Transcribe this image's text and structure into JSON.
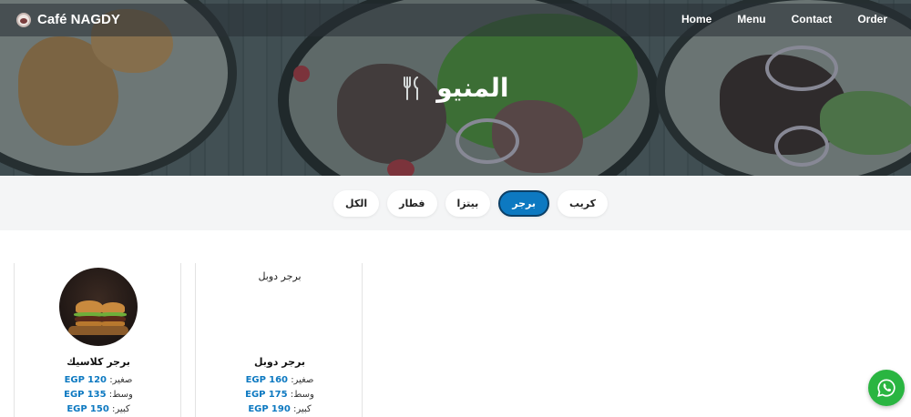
{
  "brand": {
    "name": "Café NAGDY"
  },
  "nav": {
    "links": [
      "Home",
      "Menu",
      "Contact",
      "Order"
    ]
  },
  "hero": {
    "title": "المنيو"
  },
  "filters": [
    "كريب",
    "برجر",
    "بيتزا",
    "فطار",
    "الكل"
  ],
  "active_filter": "برجر",
  "currency": "EGP",
  "cards": [
    {
      "name": "برجر كلاسيك",
      "image_alt": "",
      "prices": [
        {
          "size": "صغير:",
          "value": "120"
        },
        {
          "size": "وسط:",
          "value": "135"
        },
        {
          "size": "كبير:",
          "value": "150"
        }
      ]
    },
    {
      "name": "برجر دوبل",
      "image_alt": "برجر دوبل",
      "prices": [
        {
          "size": "صغير:",
          "value": "160"
        },
        {
          "size": "وسط:",
          "value": "175"
        },
        {
          "size": "كبير:",
          "value": "190"
        }
      ]
    }
  ],
  "colors": {
    "accent": "#0d79c1",
    "whatsapp": "#2ab541"
  },
  "icons": {
    "brand": "coffee-cup-icon",
    "hero": "fork-knife-icon",
    "float": "whatsapp-icon"
  }
}
